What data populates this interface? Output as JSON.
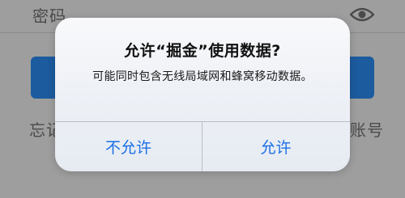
{
  "background": {
    "password_label": "密码",
    "forgot_partial": "忘记",
    "register_partial": "账号",
    "login_button_color": "#1b5b9e"
  },
  "icons": {
    "password_visibility": "eye-icon"
  },
  "alert": {
    "title": "允许“掘金”使用数据?",
    "message": "可能同时包含无线局域网和蜂窝移动数据。",
    "deny_label": "不允许",
    "allow_label": "允许",
    "button_color": "#1a6fe6"
  }
}
